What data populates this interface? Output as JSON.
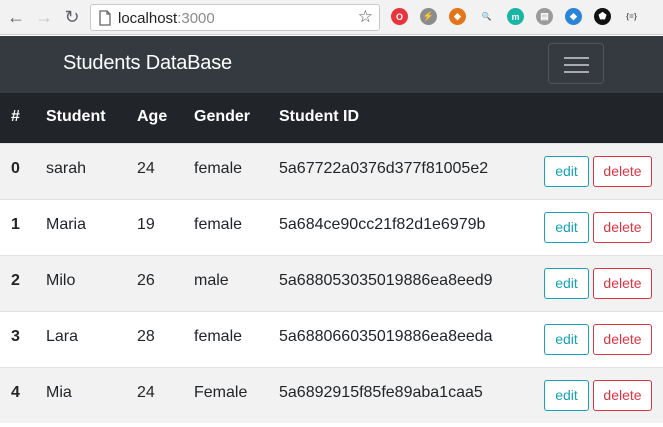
{
  "browser": {
    "url_host": "localhost",
    "url_port": ":3000",
    "extensions": [
      {
        "icon": "opera-icon",
        "glyph": "O",
        "color": "#e8353d"
      },
      {
        "icon": "bolt-icon",
        "glyph": "⚡",
        "color": "#8c8c8c"
      },
      {
        "icon": "metamask-fox-icon",
        "glyph": "◆",
        "color": "#e2761b"
      },
      {
        "icon": "magnifier-icon",
        "glyph": "🔍",
        "color": "#f2f2f2"
      },
      {
        "icon": "m-badge-icon",
        "glyph": "m",
        "color": "#19b6a6"
      },
      {
        "icon": "bookmark-stack-icon",
        "glyph": "▤",
        "color": "#9a9a9a"
      },
      {
        "icon": "ethereum-icon",
        "glyph": "◆",
        "color": "#2b84d9"
      },
      {
        "icon": "shield-icon",
        "glyph": "⬟",
        "color": "#111111"
      },
      {
        "icon": "json-braces-icon",
        "glyph": "{=}",
        "color": "#f2f2f2"
      }
    ]
  },
  "app": {
    "brand": "Students DataBase"
  },
  "table": {
    "headers": [
      "#",
      "Student",
      "Age",
      "Gender",
      "Student ID"
    ],
    "edit_label": "edit",
    "delete_label": "delete",
    "rows": [
      {
        "index": "0",
        "student": "sarah",
        "age": "24",
        "gender": "female",
        "student_id": "5a67722a0376d377f81005e2"
      },
      {
        "index": "1",
        "student": "Maria",
        "age": "19",
        "gender": "female",
        "student_id": "5a684ce90cc21f82d1e6979b"
      },
      {
        "index": "2",
        "student": "Milo",
        "age": "26",
        "gender": "male",
        "student_id": "5a688053035019886ea8eed9"
      },
      {
        "index": "3",
        "student": "Lara",
        "age": "28",
        "gender": "female",
        "student_id": "5a688066035019886ea8eeda"
      },
      {
        "index": "4",
        "student": "Mia",
        "age": "24",
        "gender": "Female",
        "student_id": "5a6892915f85fe89aba1caa5"
      }
    ]
  },
  "colors": {
    "navbar": "#343a40",
    "table_header": "#212529",
    "edit": "#17a2b8",
    "delete": "#dc3545"
  }
}
